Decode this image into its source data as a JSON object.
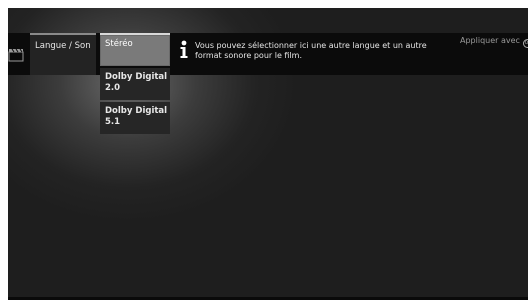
{
  "menu": {
    "label": "Langue / Son",
    "icon": "film-clapper-icon"
  },
  "submenu": {
    "options": [
      {
        "label": "Stéréo",
        "selected": true
      },
      {
        "label": "Dolby Digital 2.0",
        "selected": false
      },
      {
        "label": "Dolby Digital 5.1",
        "selected": false
      }
    ]
  },
  "info": {
    "icon": "info-icon",
    "text": "Vous pouvez sélectionner ici une autre langue et un autre format sonore pour le film."
  },
  "apply": {
    "label": "Appliquer avec",
    "button_icon": "ok-button-icon",
    "button_text": "OK"
  },
  "colors": {
    "background": "#1e1e1e",
    "bar": "#0b0b0b",
    "selected": "#7a7a7a",
    "text": "#e6e6e6"
  }
}
